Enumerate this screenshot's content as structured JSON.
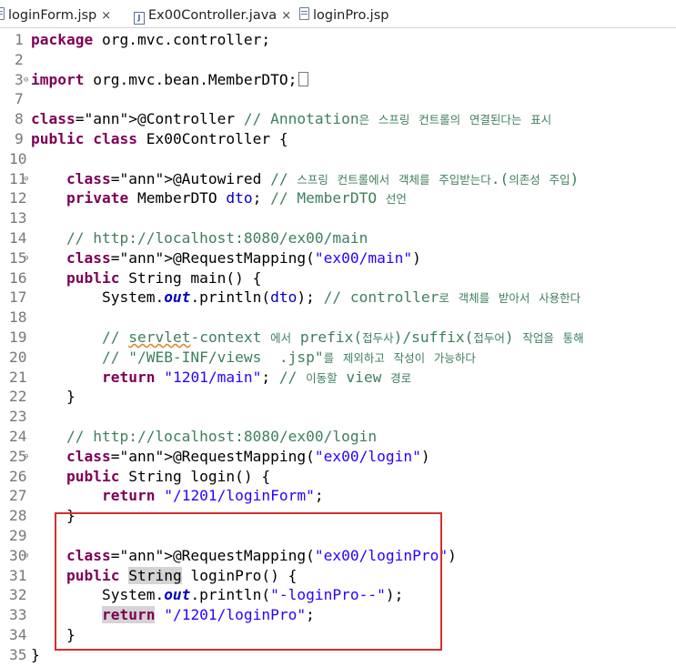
{
  "tabs": [
    {
      "label": "loginForm.jsp",
      "close": "×"
    },
    {
      "label": "Ex00Controller.java",
      "close": "×"
    },
    {
      "label": "loginPro.jsp"
    }
  ],
  "lines": [
    {
      "n": "1",
      "t": "package org.mvc.controller;"
    },
    {
      "n": "2",
      "t": ""
    },
    {
      "n": "3",
      "t": "import org.mvc.bean.MemberDTO;"
    },
    {
      "n": "7",
      "t": ""
    },
    {
      "n": "8",
      "t": "@Controller // Annotation은 스프링 컨트롤의 연결된다는 표시"
    },
    {
      "n": "9",
      "t": "public class Ex00Controller {"
    },
    {
      "n": "10",
      "t": ""
    },
    {
      "n": "11",
      "t": "    @Autowired // 스프링 컨트롤에서 객체를 주입받는다.(의존성 주입)"
    },
    {
      "n": "12",
      "t": "    private MemberDTO dto; // MemberDTO 선언"
    },
    {
      "n": "13",
      "t": ""
    },
    {
      "n": "14",
      "t": "    // http://localhost:8080/ex00/main"
    },
    {
      "n": "15",
      "t": "    @RequestMapping(\"ex00/main\")"
    },
    {
      "n": "16",
      "t": "    public String main() {"
    },
    {
      "n": "17",
      "t": "        System.out.println(dto); // controller로 객체를 받아서 사용한다"
    },
    {
      "n": "18",
      "t": ""
    },
    {
      "n": "19",
      "t": "        // servlet-context 에서 prefix(접두사)/suffix(접두어) 작업을 통해"
    },
    {
      "n": "20",
      "t": "        // \"/WEB-INF/views  .jsp\"를 제외하고 작성이 가능하다"
    },
    {
      "n": "21",
      "t": "        return \"1201/main\"; // 이동할 view 경로"
    },
    {
      "n": "22",
      "t": "    }"
    },
    {
      "n": "23",
      "t": ""
    },
    {
      "n": "24",
      "t": "    // http://localhost:8080/ex00/login"
    },
    {
      "n": "25",
      "t": "    @RequestMapping(\"ex00/login\")"
    },
    {
      "n": "26",
      "t": "    public String login() {"
    },
    {
      "n": "27",
      "t": "        return \"/1201/loginForm\";"
    },
    {
      "n": "28",
      "t": "    }"
    },
    {
      "n": "29",
      "t": ""
    },
    {
      "n": "30",
      "t": "    @RequestMapping(\"ex00/loginPro\")"
    },
    {
      "n": "31",
      "t": "    public String loginPro() {"
    },
    {
      "n": "32",
      "t": "        System.out.println(\"-loginPro--\");"
    },
    {
      "n": "33",
      "t": "        return \"/1201/loginPro\";"
    },
    {
      "n": "34",
      "t": "    }"
    },
    {
      "n": "35",
      "t": "}"
    }
  ],
  "colors": {
    "keyword": "#7f0055",
    "annotation": "#646464",
    "comment": "#3f7f5f",
    "string": "#2a00ff",
    "field": "#0000c0",
    "highlight_box": "#d32f2f"
  }
}
